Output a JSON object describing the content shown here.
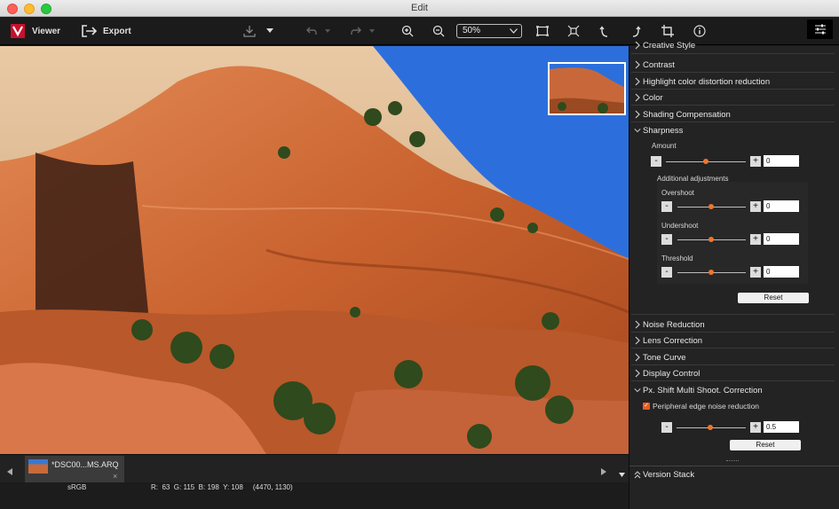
{
  "window": {
    "title": "Edit"
  },
  "toolbar": {
    "viewer_label": "Viewer",
    "export_label": "Export",
    "zoom_value": "50%"
  },
  "filmstrip": {
    "filename": "*DSC00...MS.ARQ",
    "close_glyph": "×"
  },
  "status": {
    "color_space": "sRGB",
    "pixel_info": "R:  63  G: 115  B: 198  Y: 108     (4470, 1130)"
  },
  "panel": {
    "sections_top": [
      {
        "label": "Creative Style"
      },
      {
        "label": "Contrast"
      },
      {
        "label": "Highlight color distortion reduction"
      },
      {
        "label": "Color"
      },
      {
        "label": "Shading Compensation"
      }
    ],
    "sharpness": {
      "label": "Sharpness",
      "amount_label": "Amount",
      "amount_value": "0",
      "additional_label": "Additional adjustments",
      "overshoot_label": "Overshoot",
      "overshoot_value": "0",
      "undershoot_label": "Undershoot",
      "undershoot_value": "0",
      "threshold_label": "Threshold",
      "threshold_value": "0",
      "reset_label": "Reset"
    },
    "sections_mid": [
      {
        "label": "Noise Reduction"
      },
      {
        "label": "Lens Correction"
      },
      {
        "label": "Tone Curve"
      },
      {
        "label": "Display Control"
      }
    ],
    "pixel_shift": {
      "label": "Px. Shift Multi Shoot. Correction",
      "checkbox_label": "Peripheral edge noise reduction",
      "checked": true,
      "value": "0.5",
      "reset_label": "Reset"
    },
    "version_stack_label": "Version Stack"
  },
  "colors": {
    "accent": "#f0752d",
    "sky": "#2a6bd6",
    "rock": "#c8683a"
  }
}
